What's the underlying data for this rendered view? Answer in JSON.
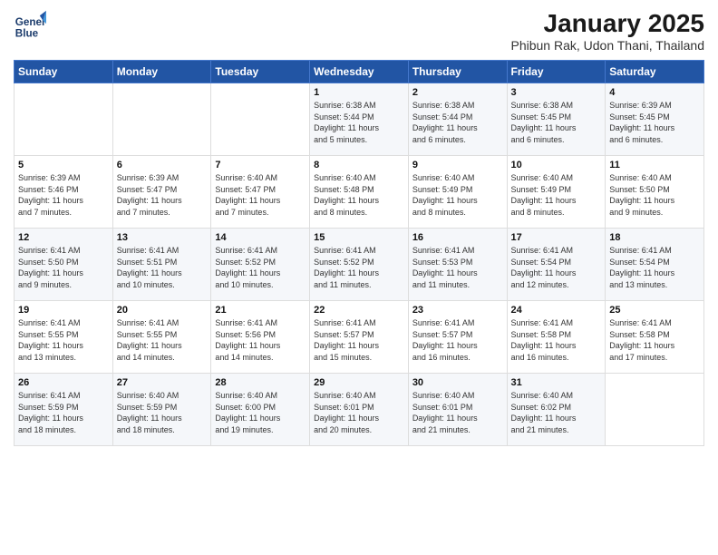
{
  "logo": {
    "line1": "General",
    "line2": "Blue"
  },
  "header": {
    "month": "January 2025",
    "location": "Phibun Rak, Udon Thani, Thailand"
  },
  "weekdays": [
    "Sunday",
    "Monday",
    "Tuesday",
    "Wednesday",
    "Thursday",
    "Friday",
    "Saturday"
  ],
  "weeks": [
    [
      {
        "day": "",
        "info": ""
      },
      {
        "day": "",
        "info": ""
      },
      {
        "day": "",
        "info": ""
      },
      {
        "day": "1",
        "info": "Sunrise: 6:38 AM\nSunset: 5:44 PM\nDaylight: 11 hours\nand 5 minutes."
      },
      {
        "day": "2",
        "info": "Sunrise: 6:38 AM\nSunset: 5:44 PM\nDaylight: 11 hours\nand 6 minutes."
      },
      {
        "day": "3",
        "info": "Sunrise: 6:38 AM\nSunset: 5:45 PM\nDaylight: 11 hours\nand 6 minutes."
      },
      {
        "day": "4",
        "info": "Sunrise: 6:39 AM\nSunset: 5:45 PM\nDaylight: 11 hours\nand 6 minutes."
      }
    ],
    [
      {
        "day": "5",
        "info": "Sunrise: 6:39 AM\nSunset: 5:46 PM\nDaylight: 11 hours\nand 7 minutes."
      },
      {
        "day": "6",
        "info": "Sunrise: 6:39 AM\nSunset: 5:47 PM\nDaylight: 11 hours\nand 7 minutes."
      },
      {
        "day": "7",
        "info": "Sunrise: 6:40 AM\nSunset: 5:47 PM\nDaylight: 11 hours\nand 7 minutes."
      },
      {
        "day": "8",
        "info": "Sunrise: 6:40 AM\nSunset: 5:48 PM\nDaylight: 11 hours\nand 8 minutes."
      },
      {
        "day": "9",
        "info": "Sunrise: 6:40 AM\nSunset: 5:49 PM\nDaylight: 11 hours\nand 8 minutes."
      },
      {
        "day": "10",
        "info": "Sunrise: 6:40 AM\nSunset: 5:49 PM\nDaylight: 11 hours\nand 8 minutes."
      },
      {
        "day": "11",
        "info": "Sunrise: 6:40 AM\nSunset: 5:50 PM\nDaylight: 11 hours\nand 9 minutes."
      }
    ],
    [
      {
        "day": "12",
        "info": "Sunrise: 6:41 AM\nSunset: 5:50 PM\nDaylight: 11 hours\nand 9 minutes."
      },
      {
        "day": "13",
        "info": "Sunrise: 6:41 AM\nSunset: 5:51 PM\nDaylight: 11 hours\nand 10 minutes."
      },
      {
        "day": "14",
        "info": "Sunrise: 6:41 AM\nSunset: 5:52 PM\nDaylight: 11 hours\nand 10 minutes."
      },
      {
        "day": "15",
        "info": "Sunrise: 6:41 AM\nSunset: 5:52 PM\nDaylight: 11 hours\nand 11 minutes."
      },
      {
        "day": "16",
        "info": "Sunrise: 6:41 AM\nSunset: 5:53 PM\nDaylight: 11 hours\nand 11 minutes."
      },
      {
        "day": "17",
        "info": "Sunrise: 6:41 AM\nSunset: 5:54 PM\nDaylight: 11 hours\nand 12 minutes."
      },
      {
        "day": "18",
        "info": "Sunrise: 6:41 AM\nSunset: 5:54 PM\nDaylight: 11 hours\nand 13 minutes."
      }
    ],
    [
      {
        "day": "19",
        "info": "Sunrise: 6:41 AM\nSunset: 5:55 PM\nDaylight: 11 hours\nand 13 minutes."
      },
      {
        "day": "20",
        "info": "Sunrise: 6:41 AM\nSunset: 5:55 PM\nDaylight: 11 hours\nand 14 minutes."
      },
      {
        "day": "21",
        "info": "Sunrise: 6:41 AM\nSunset: 5:56 PM\nDaylight: 11 hours\nand 14 minutes."
      },
      {
        "day": "22",
        "info": "Sunrise: 6:41 AM\nSunset: 5:57 PM\nDaylight: 11 hours\nand 15 minutes."
      },
      {
        "day": "23",
        "info": "Sunrise: 6:41 AM\nSunset: 5:57 PM\nDaylight: 11 hours\nand 16 minutes."
      },
      {
        "day": "24",
        "info": "Sunrise: 6:41 AM\nSunset: 5:58 PM\nDaylight: 11 hours\nand 16 minutes."
      },
      {
        "day": "25",
        "info": "Sunrise: 6:41 AM\nSunset: 5:58 PM\nDaylight: 11 hours\nand 17 minutes."
      }
    ],
    [
      {
        "day": "26",
        "info": "Sunrise: 6:41 AM\nSunset: 5:59 PM\nDaylight: 11 hours\nand 18 minutes."
      },
      {
        "day": "27",
        "info": "Sunrise: 6:40 AM\nSunset: 5:59 PM\nDaylight: 11 hours\nand 18 minutes."
      },
      {
        "day": "28",
        "info": "Sunrise: 6:40 AM\nSunset: 6:00 PM\nDaylight: 11 hours\nand 19 minutes."
      },
      {
        "day": "29",
        "info": "Sunrise: 6:40 AM\nSunset: 6:01 PM\nDaylight: 11 hours\nand 20 minutes."
      },
      {
        "day": "30",
        "info": "Sunrise: 6:40 AM\nSunset: 6:01 PM\nDaylight: 11 hours\nand 21 minutes."
      },
      {
        "day": "31",
        "info": "Sunrise: 6:40 AM\nSunset: 6:02 PM\nDaylight: 11 hours\nand 21 minutes."
      },
      {
        "day": "",
        "info": ""
      }
    ]
  ]
}
